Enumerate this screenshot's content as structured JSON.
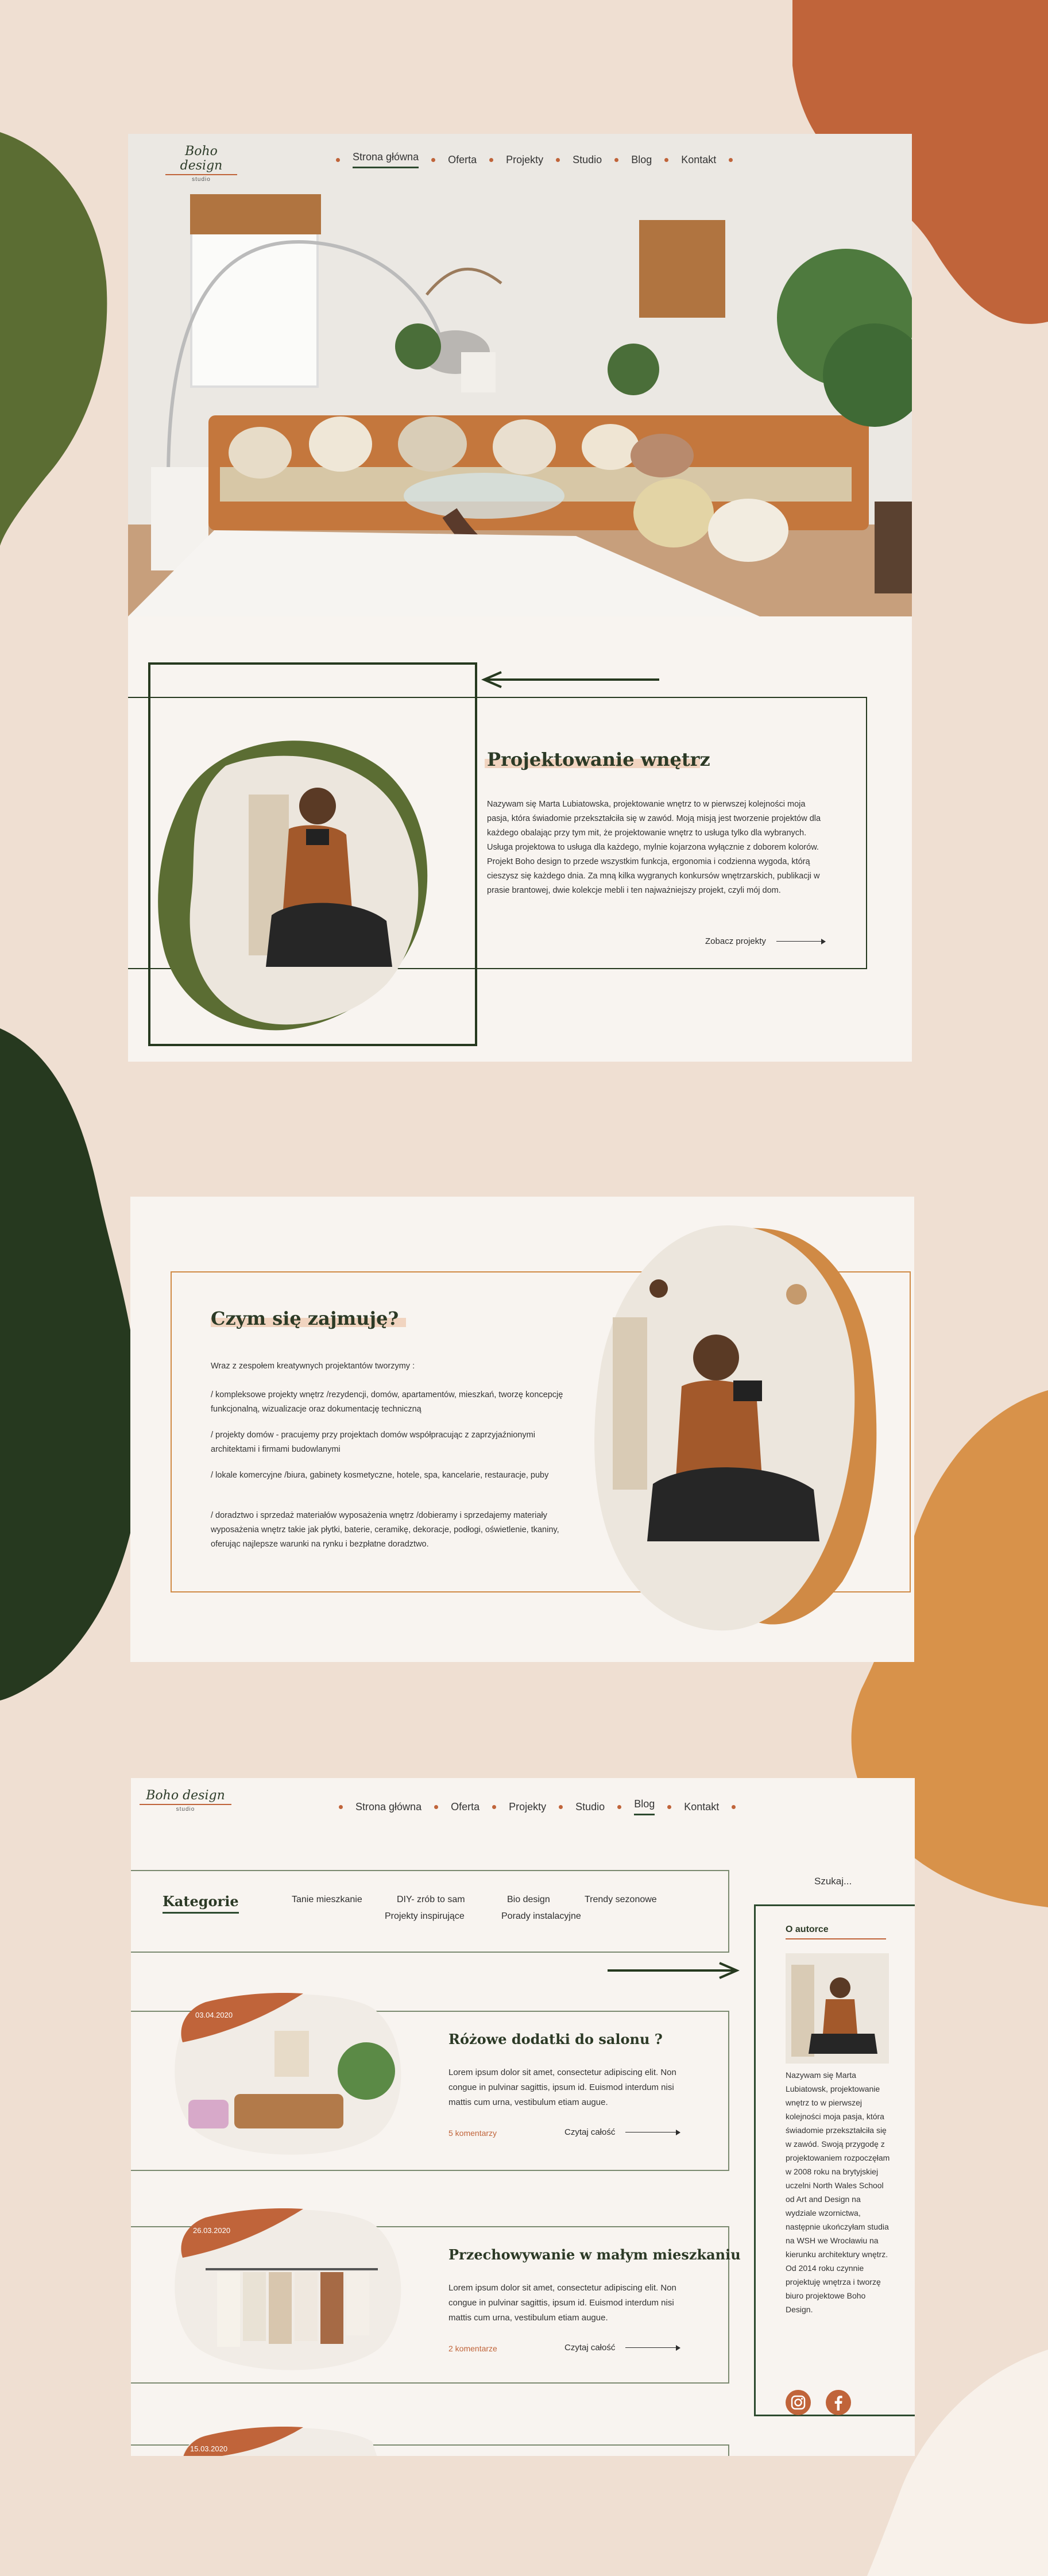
{
  "colors": {
    "background": "#efdfd2",
    "terracotta": "#c0643a",
    "olive": "#5b6d33",
    "forest": "#26391f",
    "ochre": "#d8924a",
    "panel": "#f8f4f0",
    "dark_green_text": "#2c3a26"
  },
  "logo": {
    "brand": "Boho design",
    "sub": "studio"
  },
  "nav": {
    "items": [
      "Strona główna",
      "Oferta",
      "Projekty",
      "Studio",
      "Blog",
      "Kontakt"
    ],
    "active_home": "Strona główna",
    "active_blog": "Blog"
  },
  "projekt": {
    "title": "Projektowanie wnętrz",
    "text": "Nazywam się Marta Lubiatowska, projektowanie wnętrz to w pierwszej kolejności moja pasja, która świadomie przekształciła się w zawód. Moją misją jest tworzenie projektów dla każdego obalając przy tym mit, że projektowanie wnętrz to usługa tylko dla wybranych. Usługa projektowa to usługa dla każdego, mylnie kojarzona wyłącznie z doborem kolorów. Projekt Boho design to przede wszystkim funkcja, ergonomia i codzienna wygoda, którą cieszysz się każdego dnia. Za mną kilka wygranych konkursów wnętrzarskich, publikacji w prasie brantowej, dwie kolekcje mebli i ten najważniejszy projekt, czyli mój dom.",
    "link": "Zobacz projekty"
  },
  "zajmuje": {
    "title": "Czym się zajmuję?",
    "intro": "Wraz z zespołem kreatywnych projektantów tworzymy :",
    "items": [
      "/ kompleksowe projekty wnętrz /rezydencji, domów, apartamentów, mieszkań, tworzę koncepcję funkcjonalną, wizualizacje oraz dokumentację techniczną",
      "/ projekty domów - pracujemy przy projektach domów współpracując z zaprzyjaźnionymi architektami i firmami budowlanymi",
      "/ lokale komercyjne /biura, gabinety kosmetyczne, hotele, spa, kancelarie, restauracje, puby",
      "/ doradztwo i sprzedaż materiałów wyposażenia wnętrz /dobieramy i sprzedajemy materiały wyposażenia wnętrz takie jak płytki, baterie, ceramikę, dekoracje, podłogi, oświetlenie, tkaniny, oferując najlepsze warunki na rynku i bezpłatne doradztwo."
    ]
  },
  "blog": {
    "search": "Szukaj...",
    "categories_label": "Kategorie",
    "categories": [
      "Tanie mieszkanie",
      "DIY- zrób to sam",
      "Bio design",
      "Trendy sezonowe",
      "Projekty inspirujące",
      "Porady instalacyjne"
    ],
    "posts": [
      {
        "date": "03.04.2020",
        "title": "Różowe dodatki do salonu ?",
        "text": "Lorem ipsum dolor sit amet, consectetur adipiscing elit. Non congue in pulvinar sagittis, ipsum id. Euismod interdum nisi mattis cum urna, vestibulum etiam augue.",
        "comments": "5 komentarzy",
        "link": "Czytaj całość"
      },
      {
        "date": "26.03.2020",
        "title": "Przechowywanie w małym mieszkaniu",
        "text": "Lorem ipsum dolor sit amet, consectetur adipiscing elit. Non congue in pulvinar sagittis, ipsum id. Euismod interdum nisi mattis cum urna, vestibulum etiam augue.",
        "comments": "2 komentarze",
        "link": "Czytaj całość"
      },
      {
        "date": "15.03.2020"
      }
    ],
    "author": {
      "title": "O autorce",
      "text": "Nazywam się Marta Lubiatowsk, projektowanie wnętrz to w pierwszej kolejności moja pasja, która świadomie przekształciła się w zawód. Swoją przygodę z projektowaniem rozpoczęłam w 2008 roku na brytyjskiej uczelni North Wales School od Art and Design na wydziale wzornictwa, następnie ukończyłam studia na WSH we Wrocławiu na kierunku architektury wnętrz. Od 2014 roku czynnie projektuję wnętrza i tworzę biuro projektowe Boho Design."
    },
    "social": [
      "instagram-icon",
      "facebook-icon"
    ]
  }
}
